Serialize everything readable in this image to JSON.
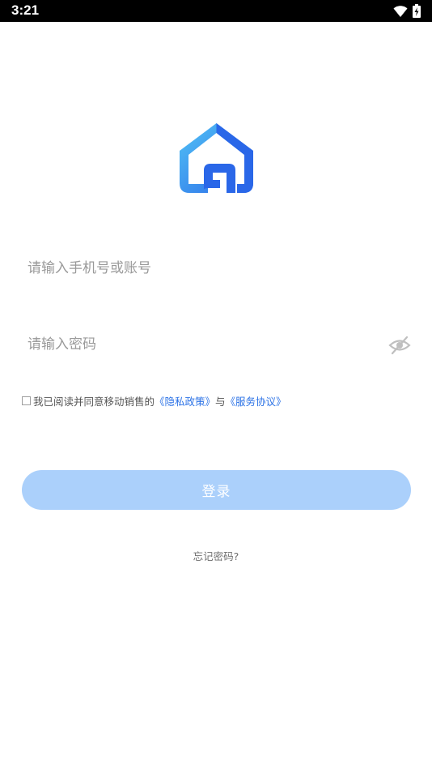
{
  "status_bar": {
    "time": "3:21",
    "icons": [
      "wifi-icon",
      "battery-charging-icon"
    ]
  },
  "logo": {
    "icon": "house-logo-icon",
    "colors": {
      "light": "#52c3f5",
      "dark": "#2a67e8"
    }
  },
  "login_form": {
    "account_placeholder": "请输入手机号或账号",
    "password_placeholder": "请输入密码",
    "password_visibility_icon": "eye-off-icon"
  },
  "agreement": {
    "prefix": "我已阅读并同意移动销售的",
    "privacy_link": "《隐私政策》",
    "conjunction": "与",
    "service_link": "《服务协议》"
  },
  "login_button": {
    "label": "登录",
    "color": "#abd0fb"
  },
  "forgot_password": {
    "label": "忘记密码?"
  }
}
